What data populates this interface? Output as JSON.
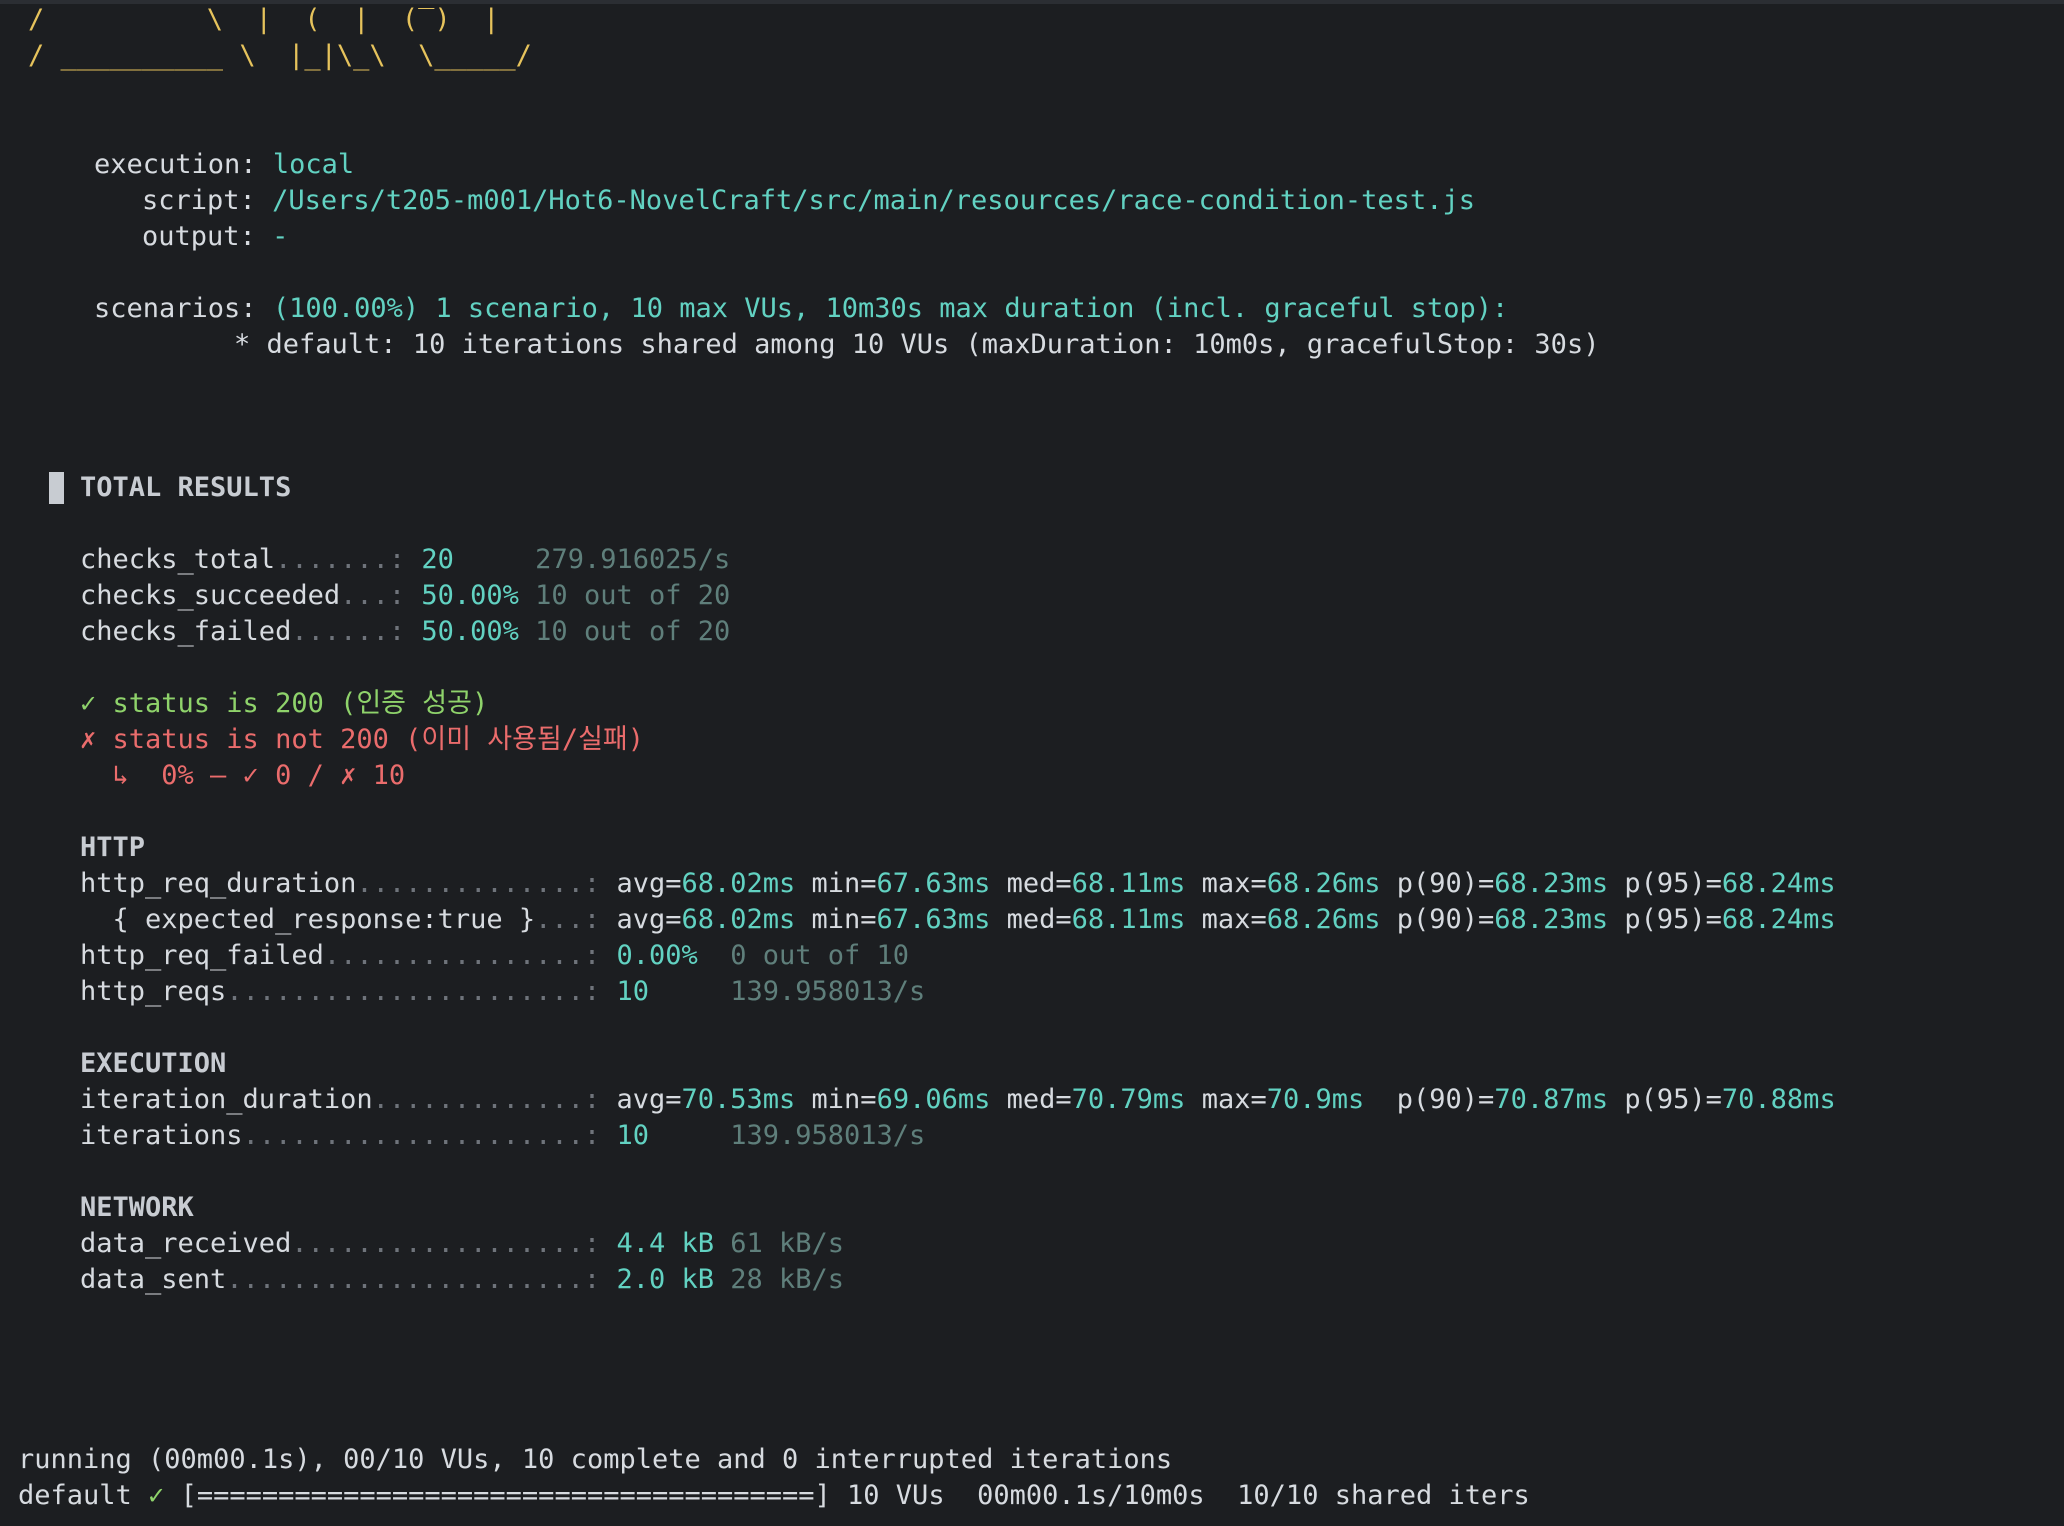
{
  "logo": {
    "art_line_1": "/          \\  |  (  |  (‾)  |",
    "art_line_2": "/ __________ \\  |_|\\_\\  \\_____/"
  },
  "header": {
    "execution_label": "execution:",
    "execution_value": "local",
    "script_label": "script:",
    "script_value": "/Users/t205-m001/Hot6-NovelCraft/src/main/resources/race-condition-test.js",
    "output_label": "output:",
    "output_value": "-",
    "scenarios_label": "scenarios:",
    "scenarios_value": "(100.00%) 1 scenario, 10 max VUs, 10m30s max duration (incl. graceful stop):",
    "scenario_default": "* default: 10 iterations shared among 10 VUs (maxDuration: 10m0s, gracefulStop: 30s)"
  },
  "total_results": {
    "title": "TOTAL RESULTS",
    "checks": [
      {
        "name": "checks_total",
        "dots": ".......: ",
        "value": "20",
        "extra": "     279.916025/s"
      },
      {
        "name": "checks_succeeded",
        "dots": "...: ",
        "value": "50.00%",
        "extra": " 10 out of 20"
      },
      {
        "name": "checks_failed",
        "dots": "......: ",
        "value": "50.00%",
        "extra": " 10 out of 20"
      }
    ],
    "check_pass": "✓ status is 200 (인증 성공)",
    "check_fail": "✗ status is not 200 (이미 사용됨/실패)",
    "check_fail_detail": "  ↳  0% — ✓ 0 / ✗ 10"
  },
  "http": {
    "title": "HTTP",
    "req_duration": {
      "name": "http_req_duration",
      "dots": "..............: ",
      "stats": [
        {
          "k": "avg=",
          "v": "68.02ms"
        },
        {
          "k": " min=",
          "v": "67.63ms"
        },
        {
          "k": " med=",
          "v": "68.11ms"
        },
        {
          "k": " max=",
          "v": "68.26ms"
        },
        {
          "k": " p(90)=",
          "v": "68.23ms"
        },
        {
          "k": " p(95)=",
          "v": "68.24ms"
        }
      ]
    },
    "expected_response": {
      "name": "  { expected_response:true }",
      "dots": "...: ",
      "stats": [
        {
          "k": "avg=",
          "v": "68.02ms"
        },
        {
          "k": " min=",
          "v": "67.63ms"
        },
        {
          "k": " med=",
          "v": "68.11ms"
        },
        {
          "k": " max=",
          "v": "68.26ms"
        },
        {
          "k": " p(90)=",
          "v": "68.23ms"
        },
        {
          "k": " p(95)=",
          "v": "68.24ms"
        }
      ]
    },
    "req_failed": {
      "name": "http_req_failed",
      "dots": "................: ",
      "value": "0.00%",
      "extra": "  0 out of 10"
    },
    "reqs": {
      "name": "http_reqs",
      "dots": "......................: ",
      "value": "10",
      "extra": "     139.958013/s"
    }
  },
  "execution": {
    "title": "EXECUTION",
    "iteration_duration": {
      "name": "iteration_duration",
      "dots": ".............: ",
      "stats": [
        {
          "k": "avg=",
          "v": "70.53ms"
        },
        {
          "k": " min=",
          "v": "69.06ms"
        },
        {
          "k": " med=",
          "v": "70.79ms"
        },
        {
          "k": " max=",
          "v": "70.9ms"
        },
        {
          "k": "  p(90)=",
          "v": "70.87ms"
        },
        {
          "k": " p(95)=",
          "v": "70.88ms"
        }
      ]
    },
    "iterations": {
      "name": "iterations",
      "dots": ".....................: ",
      "value": "10",
      "extra": "     139.958013/s"
    }
  },
  "network": {
    "title": "NETWORK",
    "data_received": {
      "name": "data_received",
      "dots": "..................: ",
      "value": "4.4 kB",
      "extra": " 61 kB/s"
    },
    "data_sent": {
      "name": "data_sent",
      "dots": "......................: ",
      "value": "2.0 kB",
      "extra": " 28 kB/s"
    }
  },
  "footer": {
    "running": "running (00m00.1s), 00/10 VUs, 10 complete and 0 interrupted iterations",
    "default_label": "default",
    "default_check": " ✓",
    "progress": " [======================================] 10 VUs  00m00.1s/10m0s  10/10 shared iters",
    "progress_fraction": 1.0
  },
  "colors": {
    "background": "#1c1e21",
    "text": "#d7dbe0",
    "teal": "#62d2c2",
    "yellow": "#e6c35c",
    "green": "#8fd36b",
    "red": "#ea6c6c",
    "dim": "#5f7f7b"
  }
}
